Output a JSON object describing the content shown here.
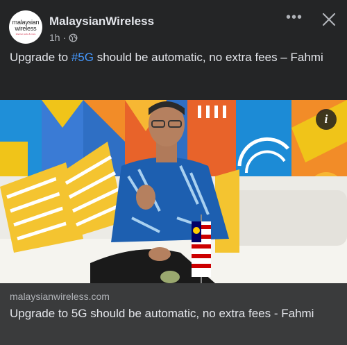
{
  "header": {
    "page_name": "MalaysianWireless",
    "logo_text_1": "malaysian",
    "logo_text_2": "wireless",
    "logo_tagline": "internet, telco & more",
    "time": "1h",
    "separator": "·",
    "privacy_icon": "globe-icon",
    "more_label": "•••",
    "close_icon": "close-icon"
  },
  "post": {
    "caption_before": "Upgrade to ",
    "hashtag": "#5G",
    "caption_after": " should be automatic, no extra fees – Fahmi"
  },
  "image": {
    "info_label": "i"
  },
  "link_preview": {
    "domain": "malaysianwireless.com",
    "title": "Upgrade to 5G should be automatic, no extra fees - Fahmi"
  },
  "colors": {
    "background": "#242526",
    "card": "#3a3b3c",
    "text": "#e4e6eb",
    "secondary_text": "#b0b3b8",
    "hashtag": "#4599ff"
  }
}
